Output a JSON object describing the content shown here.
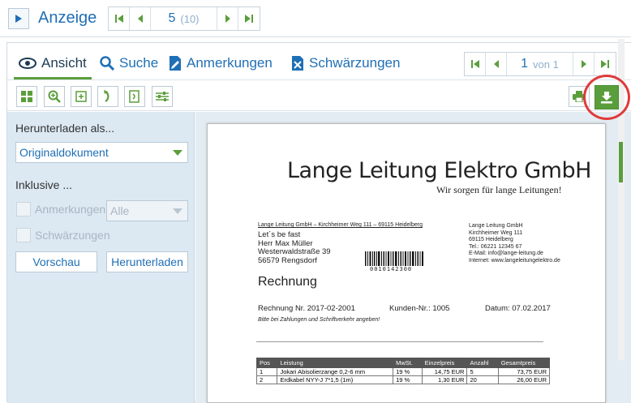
{
  "topbar": {
    "title": "Anzeige",
    "pager": {
      "current": "5",
      "total": "(10)"
    }
  },
  "tabs": [
    {
      "label": "Ansicht",
      "icon": "eye-icon",
      "active": true
    },
    {
      "label": "Suche",
      "icon": "search-icon"
    },
    {
      "label": "Anmerkungen",
      "icon": "note-icon"
    },
    {
      "label": "Schwärzungen",
      "icon": "redact-icon"
    }
  ],
  "page_pager": {
    "current": "1",
    "total": "von 1"
  },
  "sidebar": {
    "download_as_label": "Herunterladen als...",
    "format_value": "Originaldokument",
    "include_label": "Inklusive ...",
    "annotations_label": "Anmerkungen",
    "annotations_value": "Alle",
    "redactions_label": "Schwärzungen",
    "preview_button": "Vorschau",
    "download_button": "Herunterladen"
  },
  "document": {
    "company": "Lange Leitung Elektro GmbH",
    "slogan": "Wir sorgen für lange Leitungen!",
    "sender_line": "Lange Leitung GmbH – Kirchheimer Weg 111 – 69115 Heidelberg",
    "recipient": [
      "Let´s be fast",
      "Herr Max Müller",
      "Westerwaldstraße 39",
      "56579 Rengsdorf"
    ],
    "sender_block": [
      "Lange Leitung GmbH",
      "Kirchheimer Weg 111",
      "69115 Heidelberg",
      "Tel.: 06221 12345 67",
      "E-Mail: info@lange-leitung.de",
      "Internet: www.langeleitungelektro.de"
    ],
    "barcode_text": "0010142300",
    "heading": "Rechnung",
    "invoice_no": "Rechnung Nr. 2017-02-2001",
    "customer_no": "Kunden-Nr.: 1005",
    "date": "Datum: 07.02.2017",
    "note": "Bitte bei Zahlungen und Schriftverkehr angeben!",
    "table": {
      "headers": [
        "Pos",
        "Leistung",
        "MwSt.",
        "Einzelpreis",
        "Anzahl",
        "Gesamtpreis"
      ],
      "rows": [
        [
          "1",
          "Jokari Abisolierzange 0,2-6 mm",
          "19 %",
          "14,75 EUR",
          "5",
          "73,75 EUR"
        ],
        [
          "2",
          "Erdkabel NYY-J 7*1,5 (1m)",
          "19 %",
          "1,30 EUR",
          "20",
          "26,00 EUR"
        ]
      ]
    }
  },
  "colors": {
    "accent": "#1f6fb5",
    "green": "#5a9e3c",
    "highlight": "#e03a3a",
    "sidebar_bg": "#dce9f3"
  }
}
